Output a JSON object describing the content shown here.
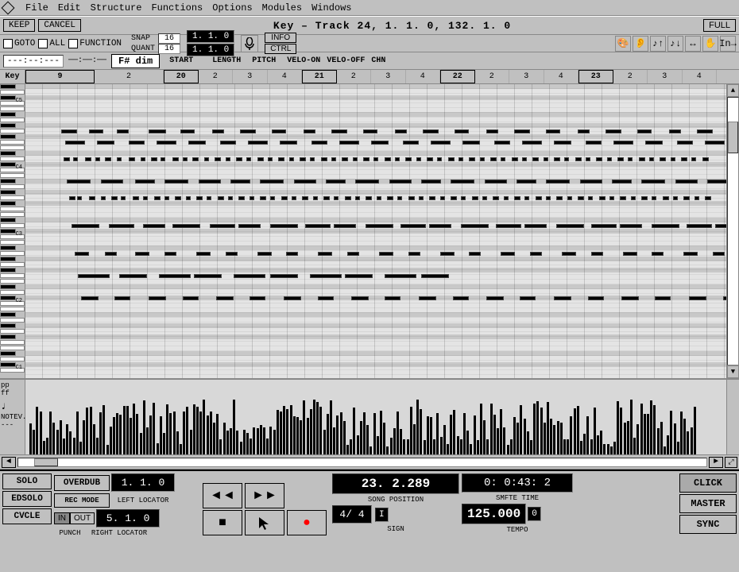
{
  "app": {
    "logo": "◇",
    "menus": [
      "File",
      "Edit",
      "Structure",
      "Functions",
      "Options",
      "Modules",
      "Windows"
    ]
  },
  "title_bar": {
    "keep_label": "KEEP",
    "cancel_label": "CANCEL",
    "title": "Key – Track 24,   1. 1.  0,  132. 1.  0",
    "full_label": "FULL"
  },
  "toolbar1": {
    "goto_label": "GOTO",
    "all_label": "ALL",
    "function_label": "FUNCTION",
    "snap_label": "SNAP",
    "snap_val": "16",
    "quant_label": "QUANT",
    "quant_val": "16",
    "position1": "1. 1.  0",
    "position2": "1. 1.  0",
    "info_label": "INFO",
    "ctrl_label": "CTRL"
  },
  "toolbar2": {
    "time_display": "---:--:---",
    "chord": "F# dim",
    "col_start": "START",
    "col_length": "LENGTH",
    "col_pitch": "PITCH",
    "col_velo_on": "VELO-ON",
    "col_velo_off": "VELO-OFF",
    "col_chn": "CHN"
  },
  "piano_roll": {
    "measures": [
      "9",
      "20",
      "21",
      "22",
      "23"
    ],
    "key_label": "Key",
    "c2_label": "C2",
    "c1_label": "C1"
  },
  "velocity": {
    "labels": [
      "pp",
      "ff"
    ],
    "note_label": "♩",
    "notev_label": "NOTEV.",
    "dashes": "---"
  },
  "transport": {
    "solo_label": "SOLO",
    "edsolo_label": "EDSOLO",
    "cycle_label": "CVCLE",
    "overdub_label": "OVERDUB",
    "rec_mode_label": "REC MODE",
    "punch_label": "PUNCH",
    "in_label": "IN",
    "out_label": "OUT",
    "left_locator_val": "1. 1.  0",
    "right_locator_val": "5. 1.  0",
    "left_locator_label": "LEFT LOCATOR",
    "right_locator_label": "RIGHT LOCATOR",
    "rewind_icon": "◄◄",
    "fastfwd_icon": "►►",
    "stop_icon": "■",
    "cursor_icon": "↖",
    "record_icon": "●",
    "song_position_val": "23. 2.289",
    "song_position_label": "SONG POSITION",
    "sign_val": "4/ 4",
    "sign_label": "SIGN",
    "smpte_val": "0: 0:43: 2",
    "smpte_label": "SMFTE TIME",
    "tempo_val": "125.000",
    "tempo_label": "TEMPO",
    "tempo_num": "0",
    "click_label": "CLICK",
    "master_label": "MASTER",
    "sync_label": "SYNC"
  }
}
